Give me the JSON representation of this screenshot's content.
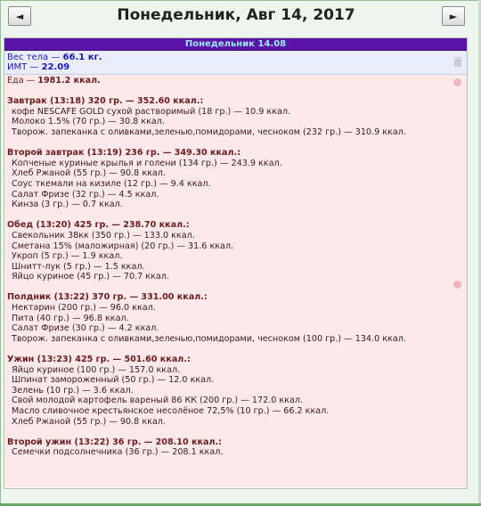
{
  "header": {
    "title": "Понедельник, Авг 14, 2017",
    "prev_label": "◄",
    "next_label": "►"
  },
  "day": {
    "label": "Понедельник 14.08",
    "weight_label": "Вес тела — ",
    "weight_value": "66.1 кг.",
    "bmi_label": "ИМТ — ",
    "bmi_value": "22.09"
  },
  "food": {
    "total_label": "Еда — ",
    "total_value": "1981.2 ккал.",
    "meals": [
      {
        "head": "Завтрак (13:18) 320 гр. — 352.60 ккал.:",
        "items": [
          "кофе NESCAFE GOLD сухой растворимый (18 гр.) — 10.9 ккал.",
          "Молоко 1.5% (70 гр.) — 30.8 ккал.",
          "Творож. запеканка с оливками,зеленью,помидорами, чесноком (232 гр.) — 310.9 ккал."
        ]
      },
      {
        "head": "Второй завтрак (13:19) 236 гр. — 349.30 ккал.:",
        "items": [
          "Копченые куриные крылья и голени (134 гр.) — 243.9 ккал.",
          "Хлеб Ржаной (55 гр.) — 90.8 ккал.",
          "Соус ткемали на кизиле (12 гр.) — 9.4 ккал.",
          "Салат Фризе (32 гр.) — 4.5 ккал.",
          "Кинза (3 гр.) — 0.7 ккал."
        ]
      },
      {
        "head": "Обед (13:20) 425 гр. — 238.70 ккал.:",
        "items": [
          "Свекольник 38кк (350 гр.) — 133.0 ккал.",
          "Сметана 15% (маложирная) (20 гр.) — 31.6 ккал.",
          "Укроп (5 гр.) — 1.9 ккал.",
          "Шнитт-лук (5 гр.) — 1.5 ккал.",
          "Яйцо куриное (45 гр.) — 70.7 ккал."
        ]
      },
      {
        "head": "Полдник (13:22) 370 гр. — 331.00 ккал.:",
        "items": [
          "Нектарин (200 гр.) — 96.0 ккал.",
          "Пита (40 гр.) — 96.8 ккал.",
          "Салат Фризе (30 гр.) — 4.2 ккал.",
          "Творож. запеканка с оливками,зеленью,помидорами, чесноком (100 гр.) — 134.0 ккал."
        ]
      },
      {
        "head": "Ужин (13:23) 425 гр. — 501.60 ккал.:",
        "items": [
          "Яйцо куриное (100 гр.) — 157.0 ккал.",
          "Шпинат замороженный (50 гр.) — 12.0 ккал.",
          "Зелень (10 гр.) — 3.6 ккал.",
          "Свой молодой картофель вареный 86 КК (200 гр.) — 172.0 ккал.",
          "Масло сливочное крестьянское несолёное 72,5% (10 гр.) — 66.2 ккал.",
          "Хлеб Ржаной (55 гр.) — 90.8 ккал."
        ]
      },
      {
        "head": "Второй ужин (13:22) 36 гр. — 208.10 ккал.:",
        "items": [
          "Семечки подсолнечника (36 гр.) — 208.1 ккал."
        ]
      }
    ]
  }
}
